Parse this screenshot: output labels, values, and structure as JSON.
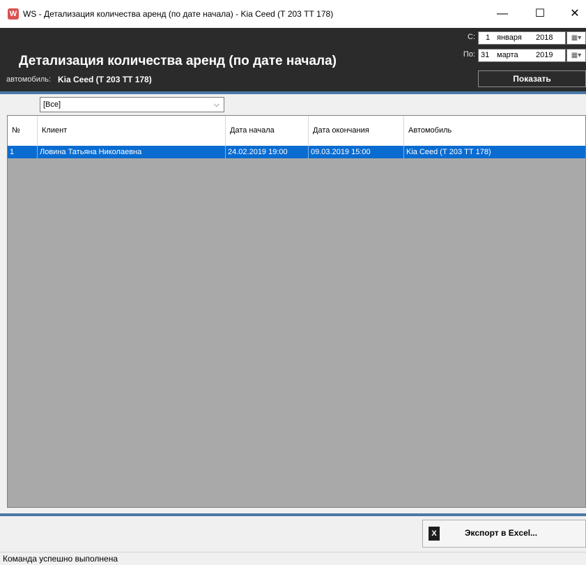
{
  "window": {
    "app_icon_letter": "W",
    "title": "WS - Детализация количества аренд (по дате начала) - Kia Ceed (Т 203 ТТ 178)",
    "minimize": "—",
    "maximize": "☐",
    "close": "✕"
  },
  "header": {
    "title": "Детализация количества аренд (по дате начала)",
    "car_label": "автомобиль:",
    "car_value": "Kia Ceed (Т 203 ТТ 178)",
    "from_label": "С:",
    "from_day": "1",
    "from_month": "января",
    "from_year": "2018",
    "to_label": "По:",
    "to_day": "31",
    "to_month": "марта",
    "to_year": "2019",
    "calendar_glyph": "▦▾",
    "show_button": "Показать"
  },
  "filter": {
    "value": "[Все]",
    "chevron": "⌵"
  },
  "table": {
    "columns": [
      "№",
      "Клиент",
      "Дата начала",
      "Дата окончания",
      "Автомобиль"
    ],
    "rows": [
      [
        "1",
        "Ловина Татьяна Николаевна",
        "24.02.2019 19:00",
        "09.03.2019 15:00",
        "Kia Ceed (Т 203 ТТ 178)"
      ]
    ]
  },
  "footer": {
    "export_button": "Экспорт в Excel...",
    "excel_icon_letter": "X"
  },
  "status": {
    "text": "Команда успешно выполнена"
  },
  "colors": {
    "header_bg": "#2b2b2b",
    "accent_bar": "#4a78a8",
    "selection": "#0a6cd1",
    "grid_empty": "#a9a9a9"
  }
}
